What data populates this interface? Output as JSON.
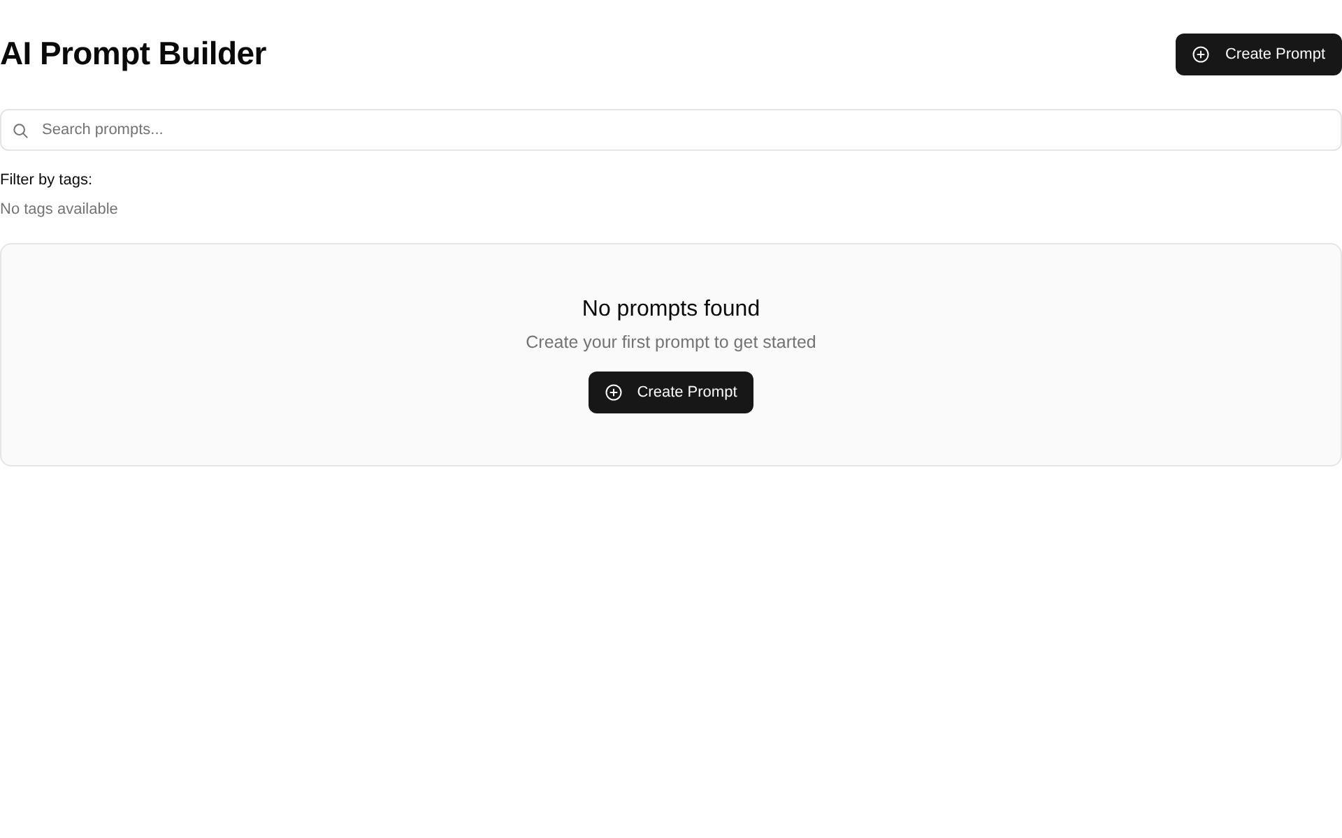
{
  "header": {
    "title": "AI Prompt Builder",
    "create_button": "Create Prompt"
  },
  "search": {
    "placeholder": "Search prompts..."
  },
  "tag_filter": {
    "label": "Filter by tags:",
    "empty_text": "No tags available"
  },
  "empty_state": {
    "title": "No prompts found",
    "subtitle": "Create your first prompt to get started",
    "button": "Create Prompt"
  }
}
